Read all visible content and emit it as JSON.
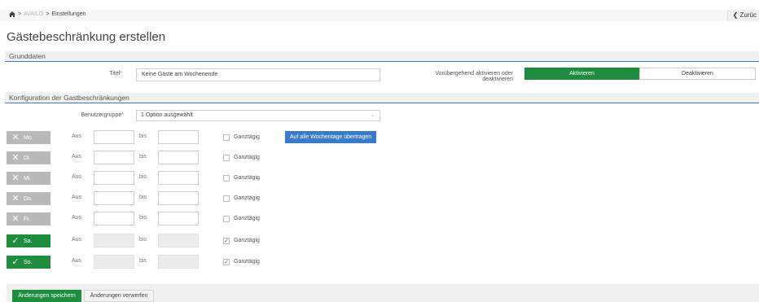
{
  "breadcrumb": {
    "home_icon": "home-icon",
    "crumb_1": "AVAILO",
    "crumb_2": "Einstellungen",
    "separator": ">"
  },
  "header": {
    "back_label": "Zurüc",
    "title": "Gästebeschränkung erstellen"
  },
  "grunddaten": {
    "section_title": "Grunddaten",
    "title_label": "Titel",
    "title_value": "Keine Gäste am Wochenende",
    "toggle_label_1": "Vorübergehend aktivieren oder",
    "toggle_label_2": "deaktivieren",
    "activate_label": "Aktivieren",
    "deactivate_label": "Deaktivieren",
    "active": true
  },
  "config": {
    "section_title": "Konfiguration der Gastbeschränkungen",
    "group_label": "Benutzergruppe",
    "group_value": "1 Option ausgewählt",
    "from_label": "Aus",
    "to_label": "bis",
    "allday_label": "Ganztägig",
    "apply_all_label": "Auf alle Wochentage übertragen",
    "days": [
      {
        "label": "Mo.",
        "enabled": false,
        "icon": "x-icon",
        "all_day": false
      },
      {
        "label": "Di.",
        "enabled": false,
        "icon": "x-icon",
        "all_day": false
      },
      {
        "label": "Mi.",
        "enabled": false,
        "icon": "x-icon",
        "all_day": false
      },
      {
        "label": "Do.",
        "enabled": false,
        "icon": "x-icon",
        "all_day": false
      },
      {
        "label": "Fr.",
        "enabled": false,
        "icon": "x-icon",
        "all_day": false
      },
      {
        "label": "Sa.",
        "enabled": true,
        "icon": "check-icon",
        "all_day": true
      },
      {
        "label": "So.",
        "enabled": true,
        "icon": "check-icon",
        "all_day": true
      }
    ]
  },
  "footer": {
    "save_label": "Änderungen speichern",
    "discard_label": "Änderungen verwerfen"
  },
  "colors": {
    "accent": "#3a7bc8",
    "success": "#1e8e3e",
    "inactive": "#b9b9b9"
  }
}
